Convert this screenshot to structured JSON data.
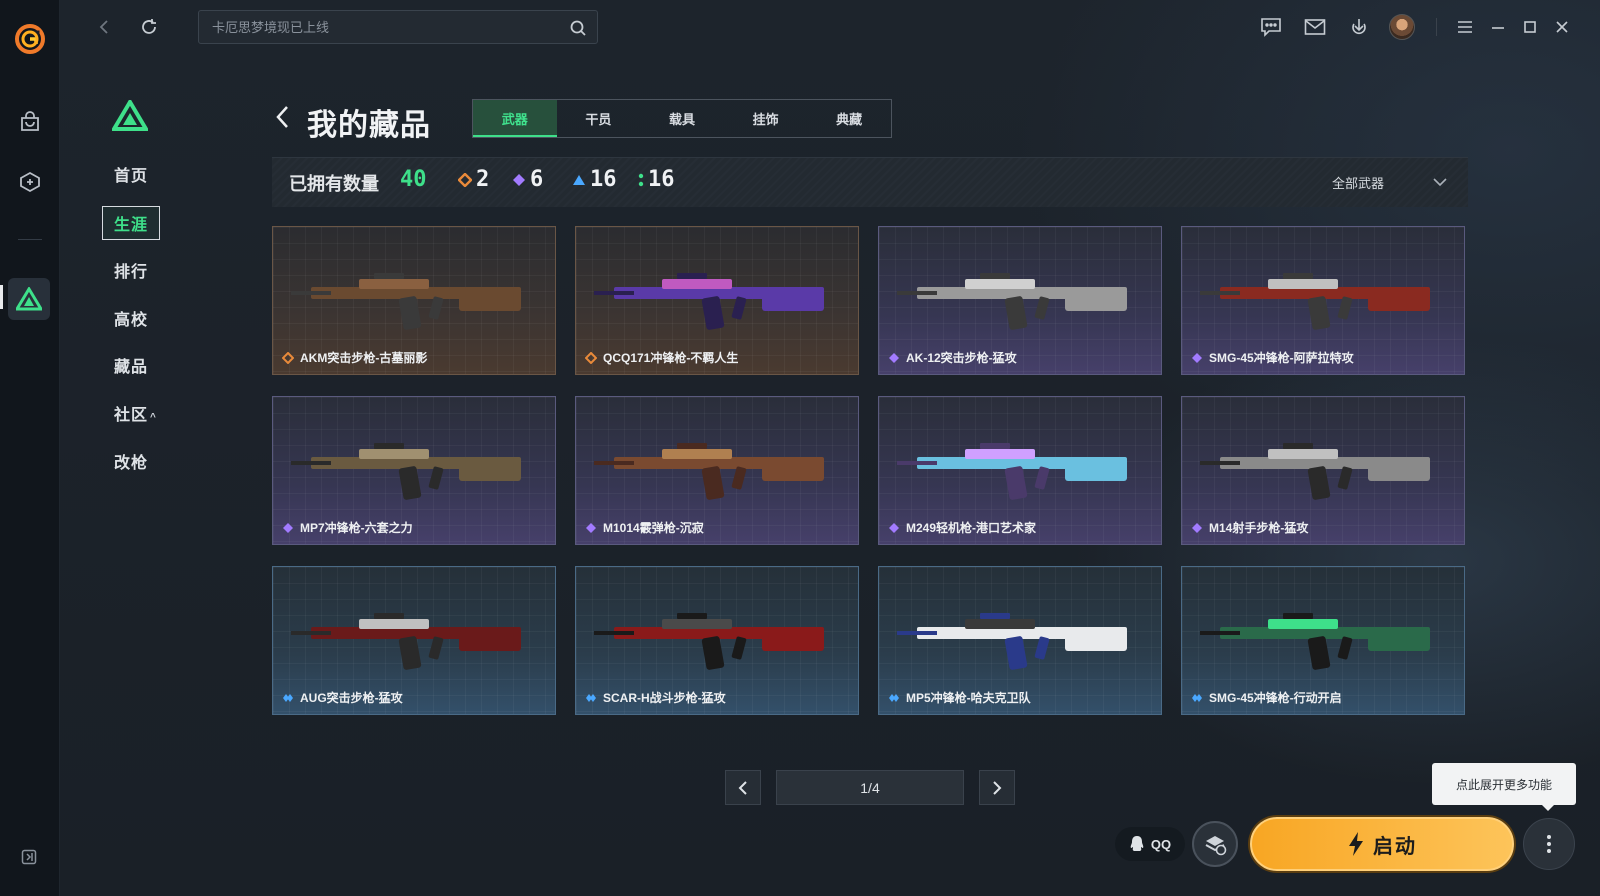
{
  "topbar": {
    "search_placeholder": "卡厄思梦境现已上线"
  },
  "subnav": {
    "items": [
      {
        "label": "首页",
        "active": false
      },
      {
        "label": "生涯",
        "active": true
      },
      {
        "label": "排行",
        "active": false
      },
      {
        "label": "高校",
        "active": false
      },
      {
        "label": "藏品",
        "active": false
      },
      {
        "label": "社区",
        "active": false,
        "caret": "^"
      },
      {
        "label": "改枪",
        "active": false
      }
    ]
  },
  "header": {
    "title": "我的藏品",
    "tabs": [
      {
        "label": "武器",
        "active": true
      },
      {
        "label": "干员",
        "active": false
      },
      {
        "label": "载具",
        "active": false
      },
      {
        "label": "挂饰",
        "active": false
      },
      {
        "label": "典藏",
        "active": false
      }
    ]
  },
  "stats": {
    "owned_label": "已拥有数量",
    "owned_count": "40",
    "counts": [
      {
        "rarity": "orange",
        "color": "#e98a3a",
        "value": "2"
      },
      {
        "rarity": "purple",
        "color": "#a27bff",
        "value": "6"
      },
      {
        "rarity": "blue",
        "color": "#4aa8ff",
        "value": "16"
      },
      {
        "rarity": "green",
        "color": "#3ee08a",
        "value": "16"
      }
    ],
    "filter_label": "全部武器"
  },
  "items": [
    {
      "name": "AKM突击步枪-古墓丽影",
      "rarity": "orange"
    },
    {
      "name": "QCQ171冲锋枪-不羁人生",
      "rarity": "orange"
    },
    {
      "name": "AK-12突击步枪-猛攻",
      "rarity": "purple"
    },
    {
      "name": "SMG-45冲锋枪-阿萨拉特攻",
      "rarity": "purple"
    },
    {
      "name": "MP7冲锋枪-六套之力",
      "rarity": "purple"
    },
    {
      "name": "M1014霰弹枪-沉寂",
      "rarity": "purple"
    },
    {
      "name": "M249轻机枪-港口艺术家",
      "rarity": "purple"
    },
    {
      "name": "M14射手步枪-猛攻",
      "rarity": "purple"
    },
    {
      "name": "AUG突击步枪-猛攻",
      "rarity": "blue"
    },
    {
      "name": "SCAR-H战斗步枪-猛攻",
      "rarity": "blue"
    },
    {
      "name": "MP5冲锋枪-哈夫克卫队",
      "rarity": "blue"
    },
    {
      "name": "SMG-45冲锋枪-行动开启",
      "rarity": "blue"
    }
  ],
  "pagination": {
    "page_text": "1/4"
  },
  "bottom": {
    "tooltip": "点此展开更多功能",
    "qq_label": "QQ",
    "launch_label": "启动"
  },
  "colors": {
    "accent_green": "#3ee08a",
    "launch_orange": "#f8a623"
  }
}
